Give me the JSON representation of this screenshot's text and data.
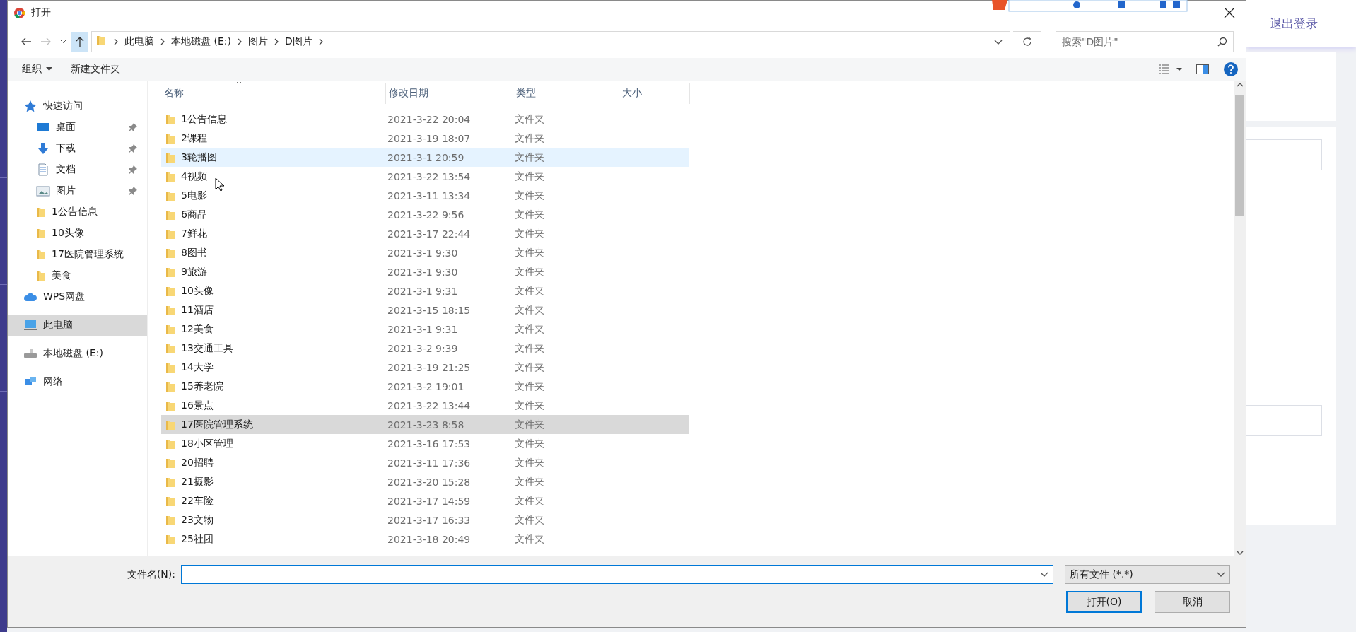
{
  "window": {
    "title": "打开"
  },
  "address": {
    "breadcrumb": [
      "此电脑",
      "本地磁盘 (E:)",
      "图片",
      "D图片"
    ],
    "search_placeholder": "搜索\"D图片\""
  },
  "toolbar": [
    {
      "label": "组织",
      "kind": "menu"
    },
    {
      "label": "新建文件夹",
      "kind": "plain"
    }
  ],
  "sidebar": {
    "items": [
      {
        "label": "快速访问",
        "kind": "quick",
        "selected": false,
        "children": [
          {
            "label": "桌面",
            "kind": "desktop",
            "pinned": true,
            "selected": false
          },
          {
            "label": "下载",
            "kind": "download",
            "pinned": true,
            "selected": false
          },
          {
            "label": "文档",
            "kind": "document",
            "pinned": true,
            "selected": false
          },
          {
            "label": "图片",
            "kind": "pictures",
            "pinned": true,
            "selected": false
          },
          {
            "label": "1公告信息",
            "kind": "folder",
            "pinned": false,
            "selected": false
          },
          {
            "label": "10头像",
            "kind": "folder",
            "pinned": false,
            "selected": false
          },
          {
            "label": "17医院管理系统",
            "kind": "folder",
            "pinned": false,
            "selected": false
          },
          {
            "label": "美食",
            "kind": "folder",
            "pinned": false,
            "selected": false
          }
        ]
      },
      {
        "label": "WPS网盘",
        "kind": "cloud",
        "selected": false
      },
      {
        "label": "此电脑",
        "kind": "computer",
        "selected": true
      },
      {
        "label": "本地磁盘 (E:)",
        "kind": "drive",
        "selected": false
      },
      {
        "label": "网络",
        "kind": "network",
        "selected": false
      }
    ]
  },
  "table": {
    "columns": [
      {
        "label": "名称",
        "sorted": true
      },
      {
        "label": "修改日期",
        "sorted": false
      },
      {
        "label": "类型",
        "sorted": false
      },
      {
        "label": "大小",
        "sorted": false
      }
    ],
    "rows": [
      {
        "name": "1公告信息",
        "date": "2021-3-22 20:04",
        "type": "文件夹",
        "hovered": false,
        "selected": false
      },
      {
        "name": "2课程",
        "date": "2021-3-19 18:07",
        "type": "文件夹",
        "hovered": false,
        "selected": false
      },
      {
        "name": "3轮播图",
        "date": "2021-3-1 20:59",
        "type": "文件夹",
        "hovered": true,
        "selected": false
      },
      {
        "name": "4视频",
        "date": "2021-3-22 13:54",
        "type": "文件夹",
        "hovered": false,
        "selected": false
      },
      {
        "name": "5电影",
        "date": "2021-3-11 13:34",
        "type": "文件夹",
        "hovered": false,
        "selected": false
      },
      {
        "name": "6商品",
        "date": "2021-3-22 9:56",
        "type": "文件夹",
        "hovered": false,
        "selected": false
      },
      {
        "name": "7鲜花",
        "date": "2021-3-17 22:44",
        "type": "文件夹",
        "hovered": false,
        "selected": false
      },
      {
        "name": "8图书",
        "date": "2021-3-1 9:30",
        "type": "文件夹",
        "hovered": false,
        "selected": false
      },
      {
        "name": "9旅游",
        "date": "2021-3-1 9:30",
        "type": "文件夹",
        "hovered": false,
        "selected": false
      },
      {
        "name": "10头像",
        "date": "2021-3-1 9:31",
        "type": "文件夹",
        "hovered": false,
        "selected": false
      },
      {
        "name": "11酒店",
        "date": "2021-3-15 18:15",
        "type": "文件夹",
        "hovered": false,
        "selected": false
      },
      {
        "name": "12美食",
        "date": "2021-3-1 9:31",
        "type": "文件夹",
        "hovered": false,
        "selected": false
      },
      {
        "name": "13交通工具",
        "date": "2021-3-2 9:39",
        "type": "文件夹",
        "hovered": false,
        "selected": false
      },
      {
        "name": "14大学",
        "date": "2021-3-19 21:25",
        "type": "文件夹",
        "hovered": false,
        "selected": false
      },
      {
        "name": "15养老院",
        "date": "2021-3-2 19:01",
        "type": "文件夹",
        "hovered": false,
        "selected": false
      },
      {
        "name": "16景点",
        "date": "2021-3-22 13:44",
        "type": "文件夹",
        "hovered": false,
        "selected": false
      },
      {
        "name": "17医院管理系统",
        "date": "2021-3-23 8:58",
        "type": "文件夹",
        "hovered": false,
        "selected": true
      },
      {
        "name": "18小区管理",
        "date": "2021-3-16 17:53",
        "type": "文件夹",
        "hovered": false,
        "selected": false
      },
      {
        "name": "20招聘",
        "date": "2021-3-11 17:36",
        "type": "文件夹",
        "hovered": false,
        "selected": false
      },
      {
        "name": "21摄影",
        "date": "2021-3-20 15:28",
        "type": "文件夹",
        "hovered": false,
        "selected": false
      },
      {
        "name": "22车险",
        "date": "2021-3-17 14:59",
        "type": "文件夹",
        "hovered": false,
        "selected": false
      },
      {
        "name": "23文物",
        "date": "2021-3-17 16:33",
        "type": "文件夹",
        "hovered": false,
        "selected": false
      },
      {
        "name": "25社团",
        "date": "2021-3-18 20:49",
        "type": "文件夹",
        "hovered": false,
        "selected": false
      }
    ]
  },
  "footer": {
    "filename_label": "文件名(N):",
    "filter": "所有文件 (*.*)",
    "buttons": [
      {
        "label": "打开(O)",
        "default": true
      },
      {
        "label": "取消",
        "default": false
      }
    ]
  },
  "background_page": {
    "logout": "退出登录"
  }
}
